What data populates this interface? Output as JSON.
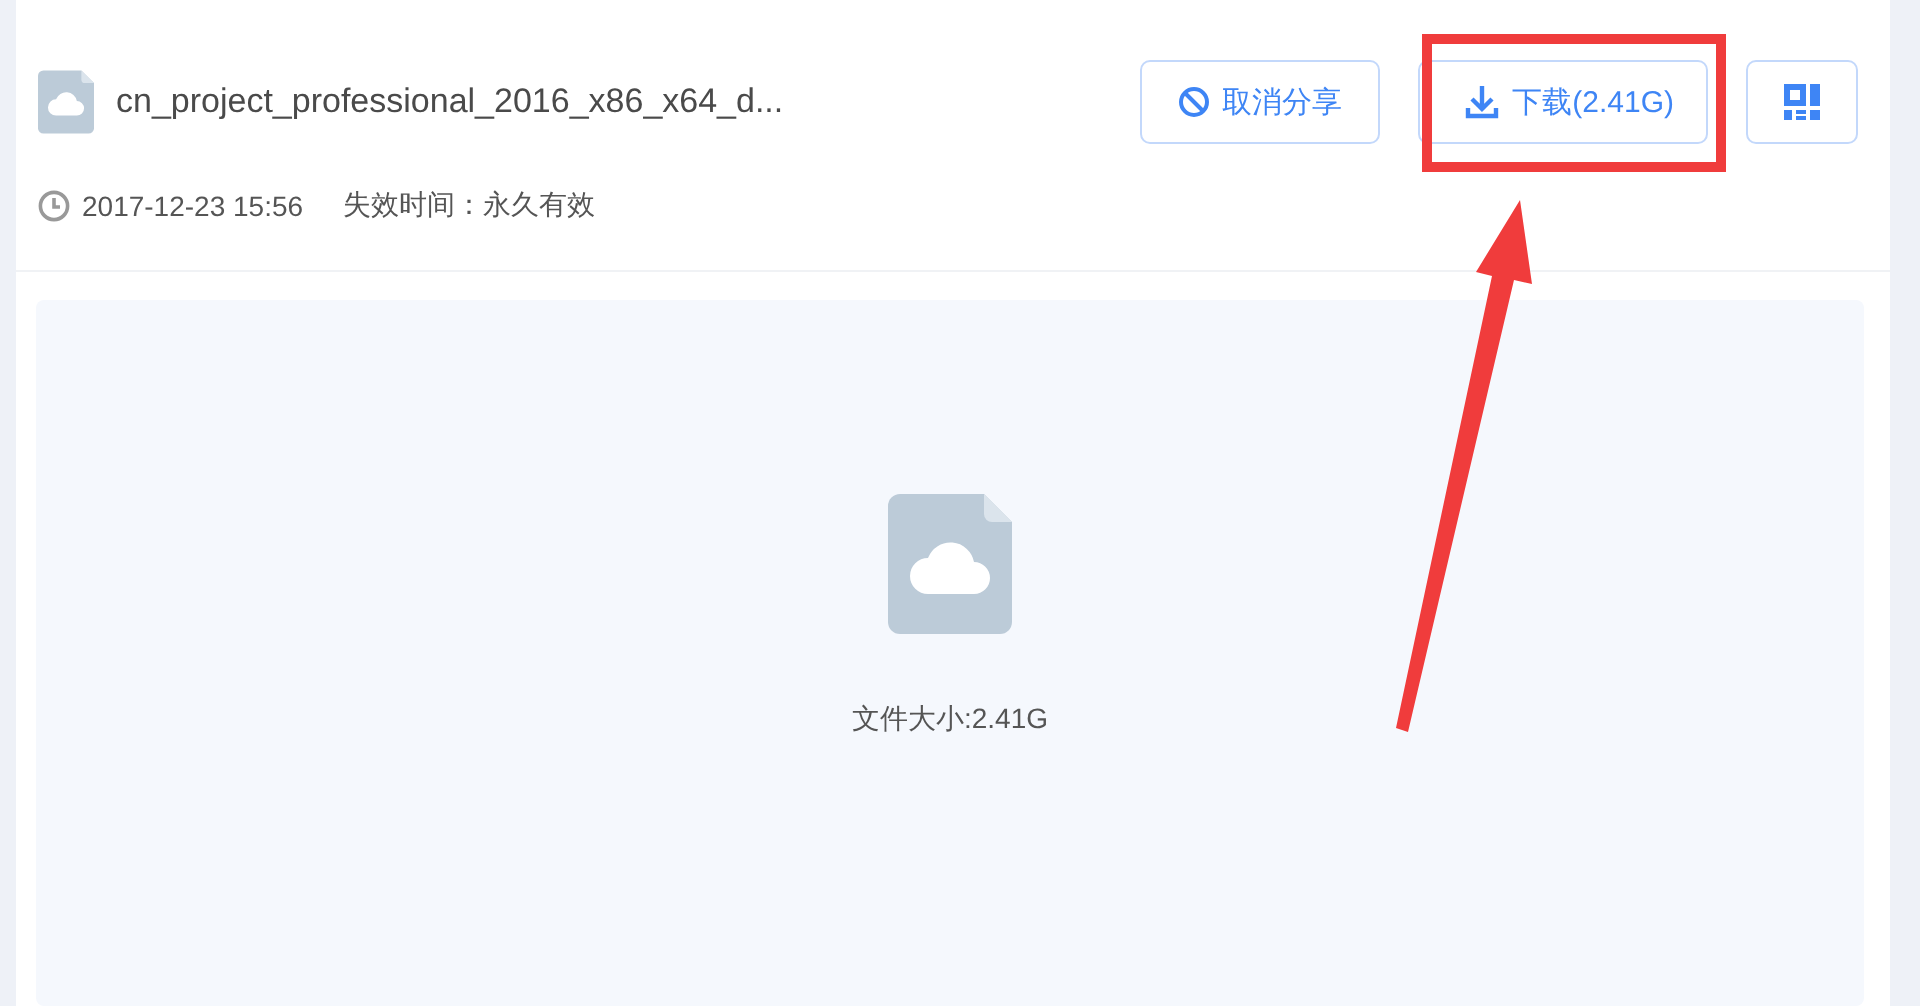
{
  "file": {
    "name": "cn_project_professional_2016_x86_x64_d...",
    "shared_time": "2017-12-23 15:56",
    "expiry": "失效时间：永久有效"
  },
  "actions": [
    {
      "kind": "cancel-share",
      "label": "取消分享"
    },
    {
      "kind": "download",
      "label": "下载(2.41G)"
    },
    {
      "kind": "qr-code"
    }
  ],
  "preview": {
    "size_text": "文件大小:2.41G"
  },
  "annotations": {
    "highlight_box": true,
    "arrow": true
  }
}
